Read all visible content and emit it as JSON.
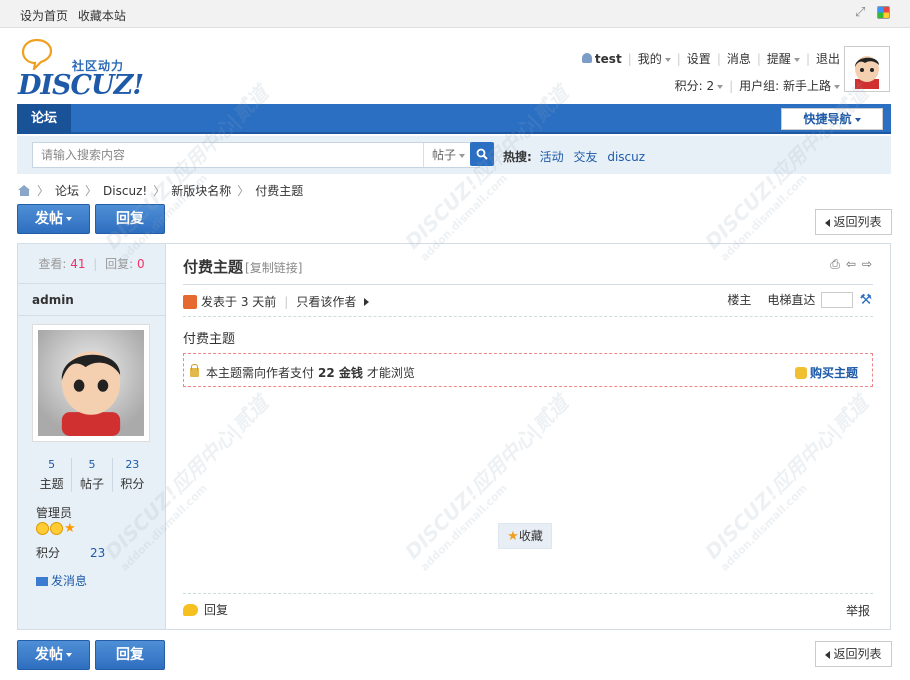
{
  "topbar": {
    "set_home": "设为首页",
    "bookmark": "收藏本站"
  },
  "logo": {
    "slogan": "社区动力",
    "brand": "DISCUZ!"
  },
  "userbar": {
    "username": "test",
    "my": "我的",
    "settings": "设置",
    "messages": "消息",
    "reminders": "提醒",
    "logout": "退出",
    "credits_label": "积分: 2",
    "group_label": "用户组: 新手上路"
  },
  "nav": {
    "forum_tab": "论坛",
    "quick_nav": "快捷导航"
  },
  "search": {
    "placeholder": "请输入搜索内容",
    "type": "帖子",
    "hot_label": "热搜:",
    "hot_words": [
      "活动",
      "交友",
      "discuz"
    ]
  },
  "breadcrumb": [
    "论坛",
    "Discuz!",
    "新版块名称",
    "付费主题"
  ],
  "actions": {
    "post": "发帖",
    "reply": "回复",
    "back_to_list": "返回列表"
  },
  "thread": {
    "views_label": "查看:",
    "views": "41",
    "replies_label": "回复:",
    "replies": "0",
    "title": "付费主题",
    "copy_link": "[复制链接]",
    "posted": "发表于 3 天前",
    "only_author": "只看该作者",
    "floor_label": "楼主",
    "jump_label": "电梯直达",
    "body": "付费主题",
    "locked_msg_pre": "本主题需向作者支付",
    "locked_amount": "22 金钱",
    "locked_msg_post": "才能浏览",
    "buy": "购买主题",
    "favorite": "收藏",
    "reply_link": "回复",
    "report": "举报"
  },
  "author": {
    "name": "admin",
    "stats": [
      {
        "num": "5",
        "label": "主题"
      },
      {
        "num": "5",
        "label": "帖子"
      },
      {
        "num": "23",
        "label": "积分"
      }
    ],
    "group": "管理员",
    "credit_label": "积分",
    "credit_value": "23",
    "send_pm": "发消息"
  }
}
